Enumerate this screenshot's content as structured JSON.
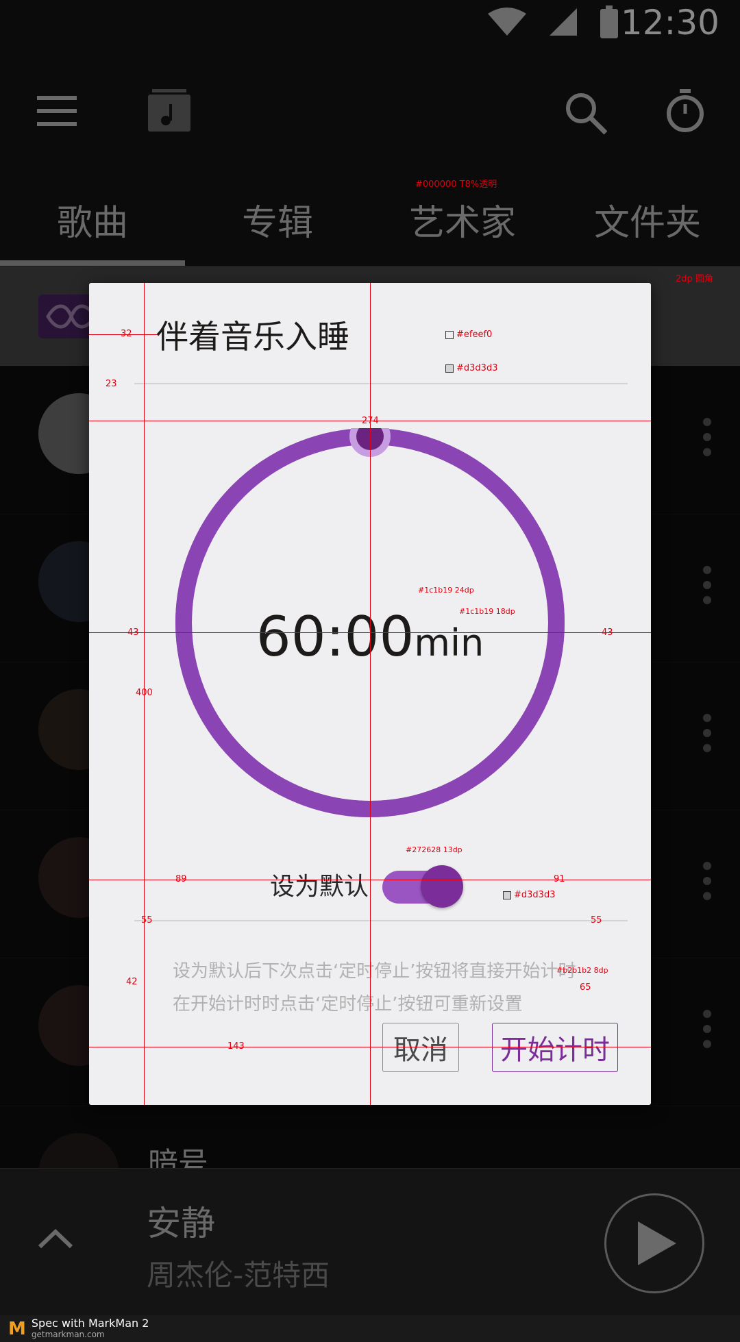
{
  "status_bar": {
    "time": "12:30",
    "icons": [
      "wifi-icon",
      "signal-icon",
      "battery-icon"
    ]
  },
  "toolbar": {
    "icons": [
      "menu-icon",
      "music-library-icon",
      "search-icon",
      "timer-icon"
    ]
  },
  "tabs": [
    {
      "label": "歌曲",
      "active": true
    },
    {
      "label": "专辑",
      "active": false
    },
    {
      "label": "艺术家",
      "active": false
    },
    {
      "label": "文件夹",
      "active": false
    }
  ],
  "dialog": {
    "title": "伴着音乐入睡",
    "timer_value": "60:00",
    "timer_unit": "min",
    "progress": 1.0,
    "default_label": "设为默认",
    "default_toggle_on": true,
    "hint_line1": "设为默认后下次点击‘定时停止’按钮将直接开始计时",
    "hint_line2": "在开始计时时点击‘定时停止’按钮可重新设置",
    "cancel_label": "取消",
    "start_label": "开始计时"
  },
  "list": {
    "peek_title": "暗号"
  },
  "now_playing": {
    "title": "安静",
    "artist": "周杰伦-范特西"
  },
  "footer": {
    "brand": "Spec with MarkMan 2",
    "url": "getmarkman.com"
  },
  "annotations": [
    {
      "text": "#000000 T8%透明",
      "key": "a1"
    },
    {
      "text": "2dp 圆角",
      "key": "a2"
    },
    {
      "text": "#efeef0",
      "key": "a3"
    },
    {
      "text": "#d3d3d3",
      "key": "a4"
    },
    {
      "text": "#1c1b19 24dp",
      "key": "a5"
    },
    {
      "text": "#1c1b19 18dp",
      "key": "a6"
    },
    {
      "text": "#272628 13dp",
      "key": "a7"
    },
    {
      "text": "#d3d3d3",
      "key": "a8"
    },
    {
      "text": "#b2b1b2 8dp",
      "key": "a9"
    }
  ],
  "dimensions": [
    "16",
    "48",
    "78",
    "32",
    "23",
    "274",
    "77",
    "189",
    "173",
    "43",
    "43",
    "400",
    "77",
    "8",
    "89",
    "91",
    "55",
    "55",
    "42",
    "134",
    "65",
    "103",
    "100",
    "98",
    "89",
    "72",
    "8",
    "143",
    "56",
    "16",
    "16",
    "16",
    "16"
  ],
  "colors": {
    "accent": "#9a55c2",
    "accent_dark": "#7b2d9a",
    "dialog_bg": "#efeef0",
    "divider": "#d3d3d3",
    "text_dark": "#1c1b19",
    "hint": "#b2b1b2",
    "annotation": "#e0000f"
  }
}
